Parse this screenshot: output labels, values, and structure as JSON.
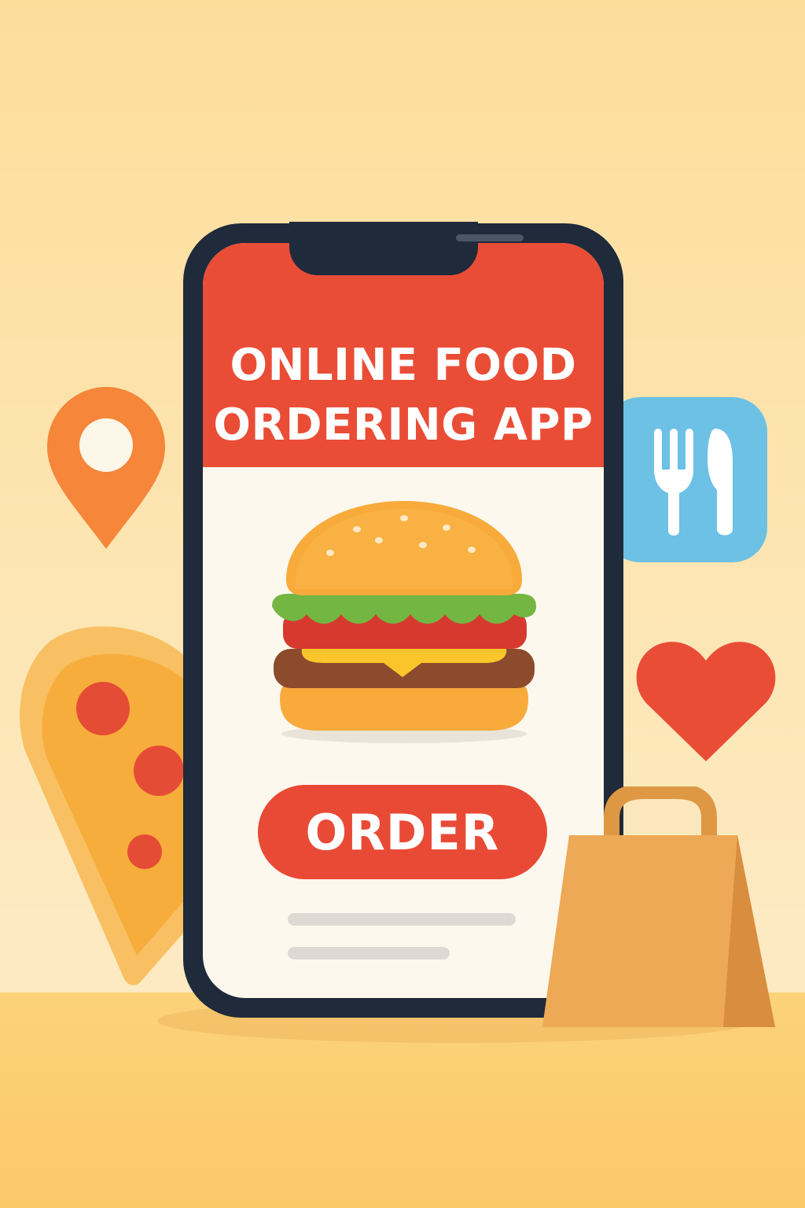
{
  "app": {
    "title": "ONLINE FOOD ORDERING APP",
    "title_line1": "ONLINE FOOD",
    "title_line2": "ORDERING APP"
  },
  "actions": {
    "order_label": "ORDER"
  },
  "icons": {
    "location": "location-pin-icon",
    "cutlery": "fork-knife-icon",
    "favorite": "heart-icon",
    "food_item": "burger-icon",
    "side_food": "pizza-slice-icon",
    "bag": "shopping-bag-icon"
  },
  "colors": {
    "brand_red": "#ea4d36",
    "phone_body": "#1f2a3a",
    "screen_bg": "#fdf8ee",
    "pin_orange": "#f5863a",
    "cutlery_blue": "#6cc1e5",
    "heart_red": "#ea4d36",
    "bag_tan": "#eda955"
  }
}
